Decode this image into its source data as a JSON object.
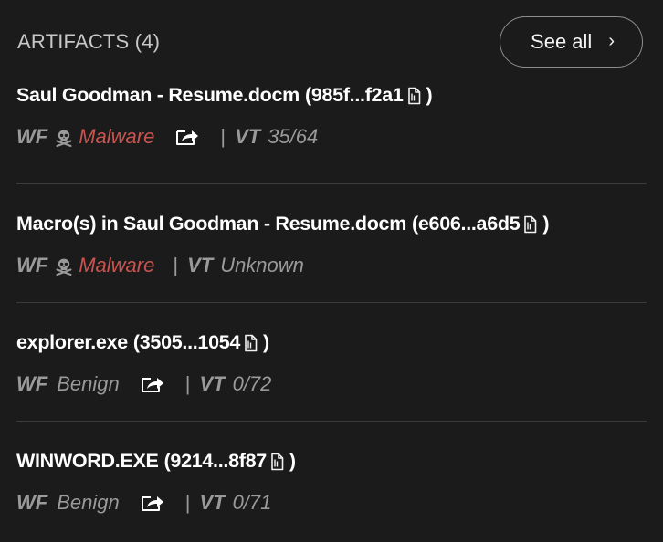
{
  "header": {
    "title": "ARTIFACTS (4)",
    "see_all_label": "See all",
    "see_all_chevron": "›"
  },
  "artifacts": [
    {
      "name": "Saul Goodman - Resume.docm",
      "hash": "(985f...f2a1",
      "paren_close": ")",
      "wf_label": "WF",
      "wf_verdict": "Malware",
      "wf_icon": "skull-crossbones-icon",
      "has_share": true,
      "sep": "|",
      "vt_label": "VT",
      "vt_value": "35/64"
    },
    {
      "name": "Macro(s) in Saul Goodman - Resume.docm",
      "hash": "(e606...a6d5",
      "paren_close": ")",
      "wf_label": "WF",
      "wf_verdict": "Malware",
      "wf_icon": "skull-crossbones-icon",
      "has_share": false,
      "sep": "|",
      "vt_label": "VT",
      "vt_value": "Unknown"
    },
    {
      "name": "explorer.exe",
      "hash": "(3505...1054",
      "paren_close": ")",
      "wf_label": "WF",
      "wf_verdict": "Benign",
      "has_share": true,
      "sep": "|",
      "vt_label": "VT",
      "vt_value": "0/72"
    },
    {
      "name": "WINWORD.EXE",
      "hash": "(9214...8f87",
      "paren_close": ")",
      "wf_label": "WF",
      "wf_verdict": "Benign",
      "has_share": true,
      "sep": "|",
      "vt_label": "VT",
      "vt_value": "0/71"
    }
  ],
  "colors": {
    "background": "#1b1b1b",
    "malware": "#c85450",
    "muted_text": "#9a9a9a",
    "divider": "#3b3b3b"
  }
}
